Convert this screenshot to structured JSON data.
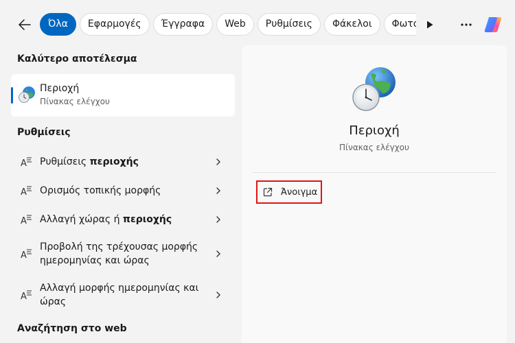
{
  "filters": {
    "tabs": [
      {
        "label": "Όλα",
        "active": true
      },
      {
        "label": "Εφαρμογές"
      },
      {
        "label": "Έγγραφα"
      },
      {
        "label": "Web"
      },
      {
        "label": "Ρυθμίσεις"
      },
      {
        "label": "Φάκελοι"
      },
      {
        "label": "Φωτογραφίες"
      }
    ],
    "more_label": "···"
  },
  "best_match": {
    "heading": "Καλύτερο αποτέλεσμα",
    "title": "Περιοχή",
    "subtitle": "Πίνακας ελέγχου"
  },
  "settings": {
    "heading": "Ρυθμίσεις",
    "items": [
      {
        "pre": "Ρυθμίσεις ",
        "bold": "περιοχής",
        "line2": ""
      },
      {
        "pre": "Ορισμός τοπικής μορφής",
        "bold": "",
        "line2": ""
      },
      {
        "pre": "Αλλαγή χώρας ή ",
        "bold": "περιοχής",
        "line2": ""
      },
      {
        "pre": "Προβολή της τρέχουσας μορφής",
        "bold": "",
        "line2": "ημερομηνίας και ώρας"
      },
      {
        "pre": "Αλλαγή μορφής ημερομηνίας και",
        "bold": "",
        "line2": "ώρας"
      }
    ]
  },
  "web_search": {
    "heading": "Αναζήτηση στο web"
  },
  "detail": {
    "title": "Περιοχή",
    "subtitle": "Πίνακας ελέγχου",
    "open_label": "Άνοιγμα"
  },
  "colors": {
    "accent": "#0067c0",
    "highlight_box": "#e01414"
  },
  "icons": [
    "back-arrow-icon",
    "play-icon",
    "more-icon",
    "copilot-icon",
    "region-globe-clock-icon",
    "settings-text-icon",
    "chevron-right-icon",
    "open-external-icon"
  ]
}
